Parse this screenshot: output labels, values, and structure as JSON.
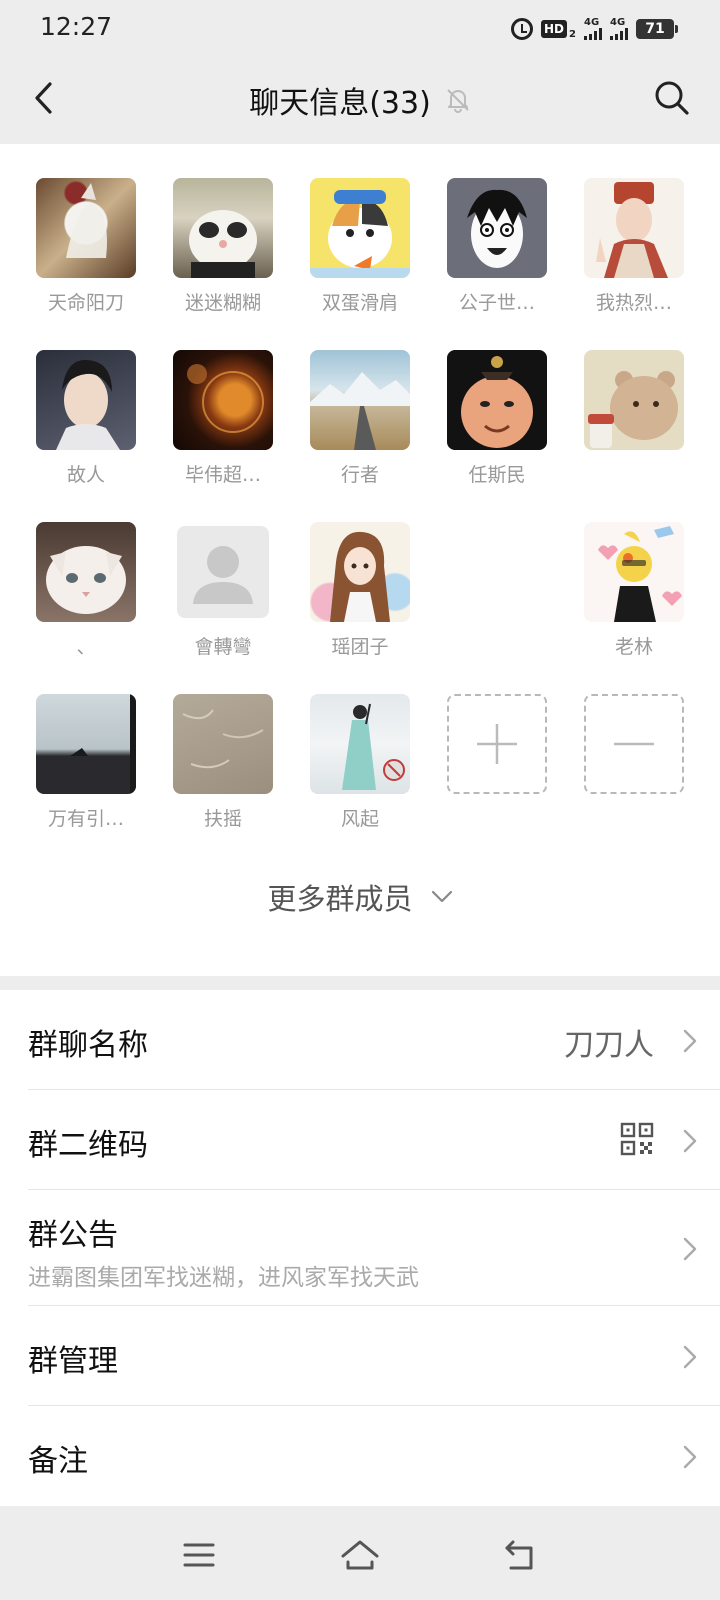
{
  "status_bar": {
    "time": "12:27",
    "hd_label": "HD",
    "hd_sub": "2",
    "network_1": "4G",
    "network_2": "4G",
    "battery": "71"
  },
  "header": {
    "title": "聊天信息(33)",
    "back_icon": "chevron-left-icon",
    "mute_icon": "bell-off-icon",
    "search_icon": "search-icon"
  },
  "members": [
    {
      "name": "天命阳刀"
    },
    {
      "name": "迷迷糊糊"
    },
    {
      "name": "双蛋滑肩"
    },
    {
      "name": "公子世…"
    },
    {
      "name": "我热烈…"
    },
    {
      "name": "故人"
    },
    {
      "name": "毕伟超…"
    },
    {
      "name": "行者"
    },
    {
      "name": "任斯民"
    },
    {
      "name": ""
    },
    {
      "name": "、"
    },
    {
      "name": "會轉彎"
    },
    {
      "name": "瑶团子"
    },
    {
      "name": ""
    },
    {
      "name": "老林"
    },
    {
      "name": "万有引…"
    },
    {
      "name": "扶摇"
    },
    {
      "name": "风起"
    }
  ],
  "member_actions": {
    "add_icon": "plus-icon",
    "remove_icon": "minus-icon"
  },
  "more_members": {
    "label": "更多群成员",
    "icon": "chevron-down-icon"
  },
  "settings": {
    "group_name": {
      "label": "群聊名称",
      "value": "刀刀人"
    },
    "qr_code": {
      "label": "群二维码",
      "icon": "qr-code-icon"
    },
    "announcement": {
      "label": "群公告",
      "text": "进霸图集团军找迷糊，进风家军找天武"
    },
    "management": {
      "label": "群管理"
    },
    "remark": {
      "label": "备注"
    }
  },
  "nav_bar": {
    "menu_icon": "menu-icon",
    "home_icon": "home-icon",
    "back_icon": "back-arrow-icon"
  },
  "colors": {
    "background": "#ededed",
    "card": "#ffffff",
    "muted_text": "#999999"
  }
}
